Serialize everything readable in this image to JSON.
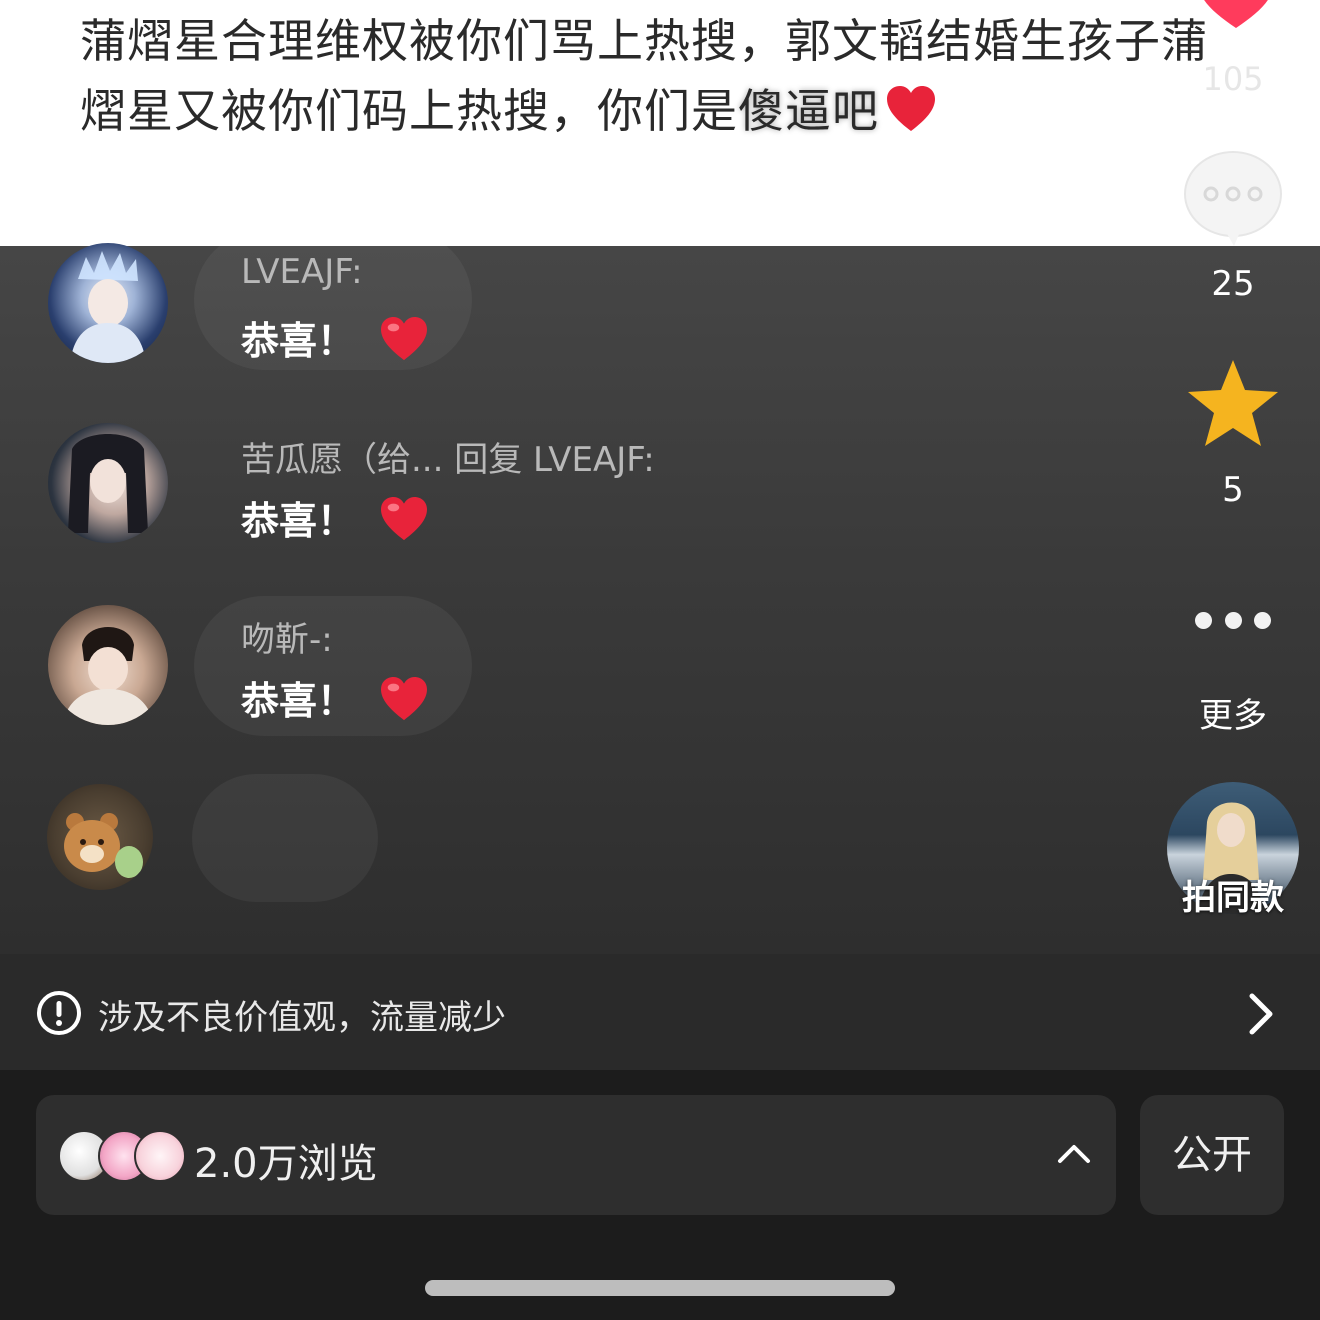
{
  "post": {
    "text_part1": "蒲熠星合理维权被你们骂上热搜，郭文韬结婚生孩子蒲熠星又被你们码上热搜，你们是",
    "text_part2": "傻逼吧",
    "like_count": "105"
  },
  "comments": [
    {
      "name": "LVEAJF:",
      "text": "恭喜！"
    },
    {
      "name": "苦瓜愿（给... 回复 LVEAJF:",
      "text": "恭喜！"
    },
    {
      "name": "吻靳-:",
      "text": "恭喜！"
    }
  ],
  "side": {
    "comment_count": "25",
    "favorite_count": "5",
    "more_label": "更多",
    "same_label": "拍同款"
  },
  "warning": {
    "text": "涉及不良价值观，流量减少"
  },
  "bottom": {
    "views_text": "2.0万浏览",
    "public_label": "公开"
  },
  "colors": {
    "heart": "#e8233a",
    "star": "#f5b41f",
    "like_heart": "#ff3b5c"
  }
}
